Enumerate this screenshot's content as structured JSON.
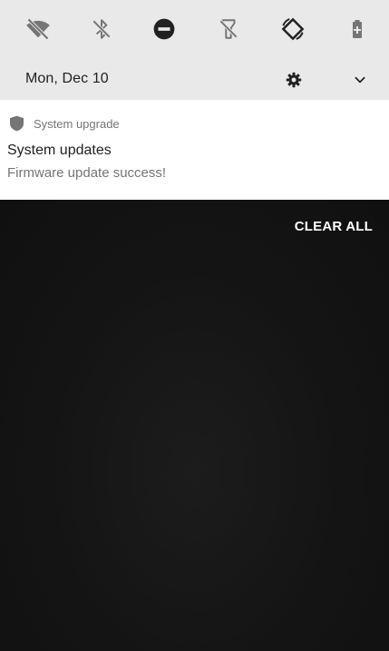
{
  "quick_settings": {
    "tiles": [
      {
        "name": "wifi-off-icon"
      },
      {
        "name": "bluetooth-off-icon"
      },
      {
        "name": "do-not-disturb-icon"
      },
      {
        "name": "flashlight-off-icon"
      },
      {
        "name": "auto-rotate-icon"
      },
      {
        "name": "battery-saver-icon"
      }
    ],
    "icon_color": "#757575",
    "dark_icon_color": "#212121"
  },
  "status": {
    "date": "Mon, Dec 10",
    "settings_icon": "gear-icon",
    "expand_icon": "chevron-down-icon"
  },
  "notification": {
    "app_icon": "shield-icon",
    "app_name": "System upgrade",
    "title": "System updates",
    "text": "Firmware update success!"
  },
  "shade": {
    "clear_all_label": "CLEAR ALL"
  }
}
